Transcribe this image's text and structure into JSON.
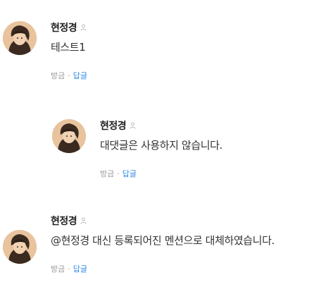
{
  "comments": [
    {
      "author": "현정경",
      "text": "테스트1",
      "like_label": "방금",
      "separator": "·",
      "reply_label": "답글",
      "avatar_icon": "avatar-icon",
      "author_icon": "person-icon"
    },
    {
      "author": "현정경",
      "text": "대댓글은 사용하지 않습니다.",
      "like_label": "방금",
      "separator": "·",
      "reply_label": "답글",
      "avatar_icon": "avatar-icon",
      "author_icon": "person-icon"
    },
    {
      "author": "현정경",
      "text": "@현정경 대신 등록되어진 멘션으로 대체하였습니다.",
      "like_label": "방금",
      "separator": "·",
      "reply_label": "답글",
      "avatar_icon": "avatar-icon",
      "author_icon": "person-icon"
    }
  ],
  "colors": {
    "reply_link": "#2d89e6",
    "muted": "#999999",
    "avatar_bg": "#e2b893"
  }
}
